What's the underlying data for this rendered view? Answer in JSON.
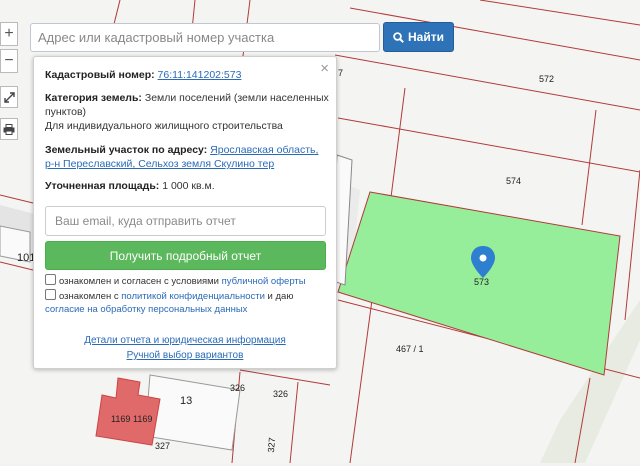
{
  "search": {
    "placeholder": "Адрес или кадастровый номер участка",
    "button_label": "Найти",
    "button_icon": "search-icon"
  },
  "map_controls": {
    "zoom_in": "+",
    "zoom_out": "−",
    "expand_icon": "expand-icon",
    "print_icon": "print-icon"
  },
  "map": {
    "colors": {
      "highlight": "#96ee9a",
      "boundary": "#b23a3a",
      "building": "#e06a6a",
      "pin": "#2f7fd1"
    },
    "parcel_labels": [
      "572",
      "574",
      "573",
      "467 / 1",
      "326",
      "326",
      "327",
      "327",
      "1169",
      "1169",
      "13",
      "101",
      "7"
    ]
  },
  "panel": {
    "cadastral_label": "Кадастровый номер:",
    "cadastral_value": "76:11:141202:573",
    "category_label": "Категория земель:",
    "category_value": "Земли поселений (земли населенных пунктов)",
    "category_use": "Для индивидуального жилищного строительства",
    "address_label": "Земельный участок по адресу:",
    "address_value_1": "Ярославская область,",
    "address_value_2": "р-н Переславский, Сельхоз земля Скулино тер",
    "area_label": "Уточненная площадь:",
    "area_value": "1 000 кв.м.",
    "email_placeholder": "Ваш email, куда отправить отчет",
    "report_button": "Получить подробный отчет",
    "agree1_text": "ознакомлен и согласен с условиями ",
    "agree1_link": "публичной оферты",
    "agree2_text": "ознакомлен с ",
    "agree2_link": "политикой конфиденциальности",
    "agree2_mid": " и даю",
    "agree2_link2": "согласие на обработку персональных данных",
    "details_link": "Детали отчета и юридическая информация",
    "manual_link": "Ручной выбор вариантов",
    "close": "×"
  }
}
